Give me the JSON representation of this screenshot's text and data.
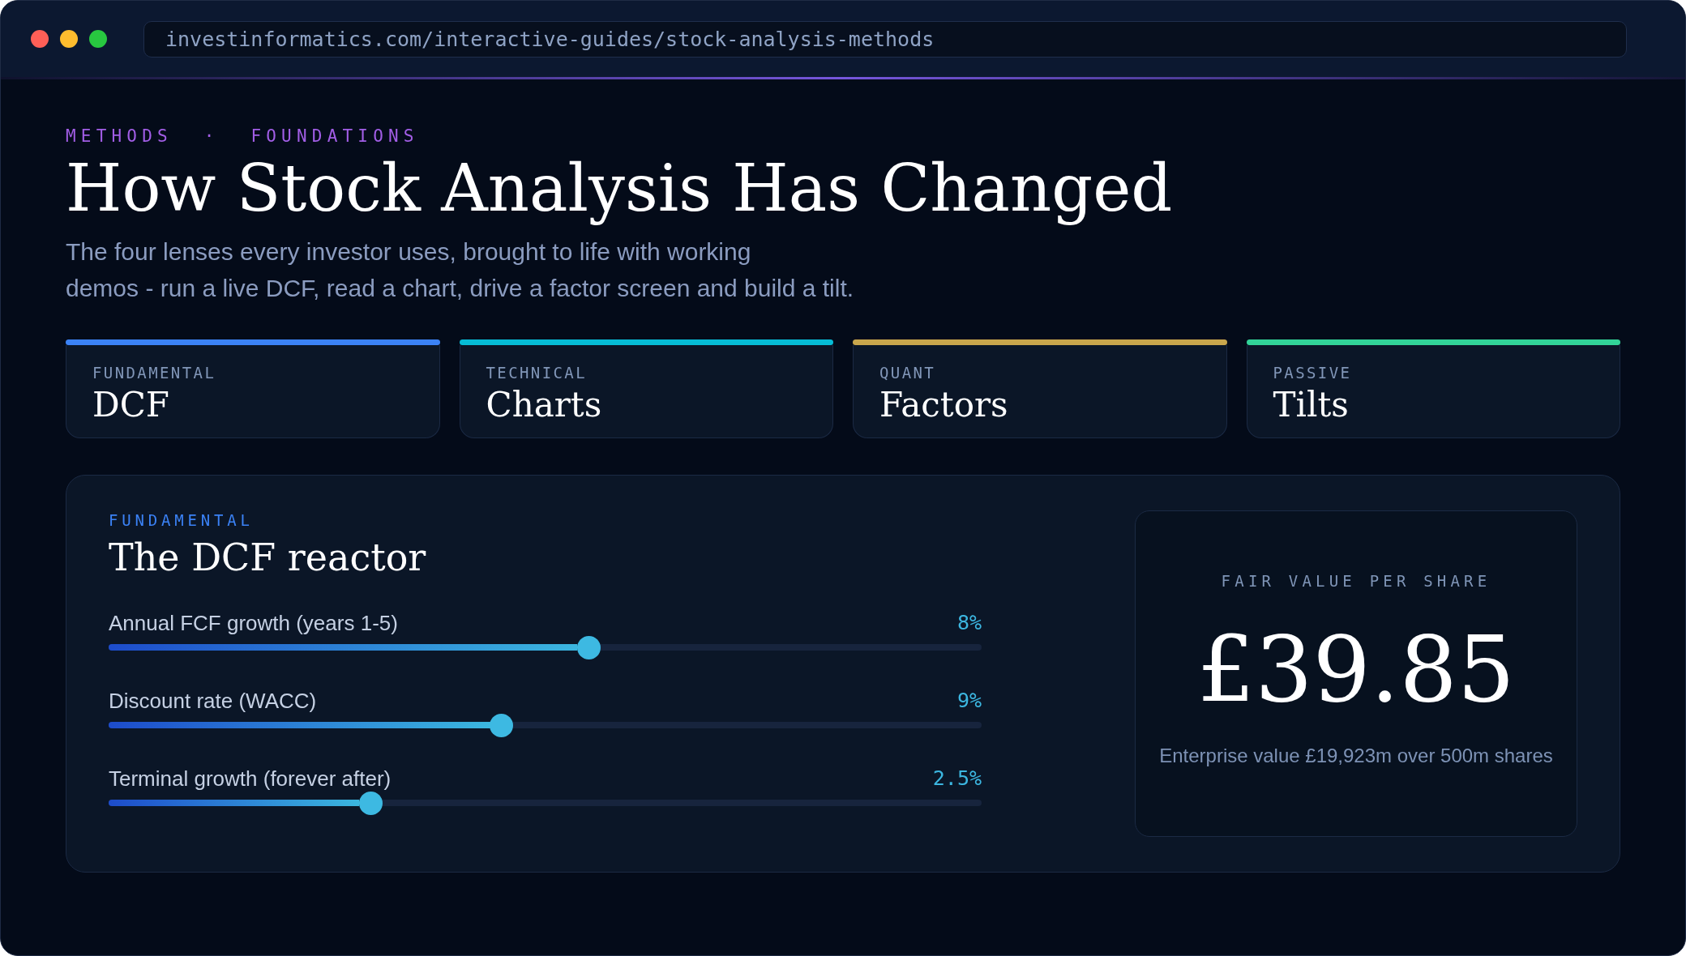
{
  "window": {
    "url": "investinformatics.com/interactive-guides/stock-analysis-methods"
  },
  "header": {
    "eyebrow": "METHODS · FOUNDATIONS",
    "title": "How Stock Analysis Has Changed",
    "subtitle": "The four lenses every investor uses, brought to life with working\ndemos - run a live DCF, read a chart, drive a factor screen and build a tilt."
  },
  "method_cards": [
    {
      "category": "FUNDAMENTAL",
      "title": "DCF",
      "color": "#3b82f6"
    },
    {
      "category": "TECHNICAL",
      "title": "Charts",
      "color": "#06bcd6"
    },
    {
      "category": "QUANT",
      "title": "Factors",
      "color": "#c9a64c"
    },
    {
      "category": "PASSIVE",
      "title": "Tilts",
      "color": "#32d398"
    }
  ],
  "dcf_panel": {
    "eyebrow": "FUNDAMENTAL",
    "title": "The DCF reactor",
    "sliders": [
      {
        "label": "Annual FCF growth (years 1-5)",
        "reading": "8%",
        "level": 0.55
      },
      {
        "label": "Discount rate (WACC)",
        "reading": "9%",
        "level": 0.45
      },
      {
        "label": "Terminal growth (forever after)",
        "reading": "2.5%",
        "level": 0.3
      }
    ],
    "result": {
      "label": "FAIR VALUE PER SHARE",
      "value": "£39.85",
      "note": "Enterprise value £19,923m over 500m shares"
    }
  }
}
